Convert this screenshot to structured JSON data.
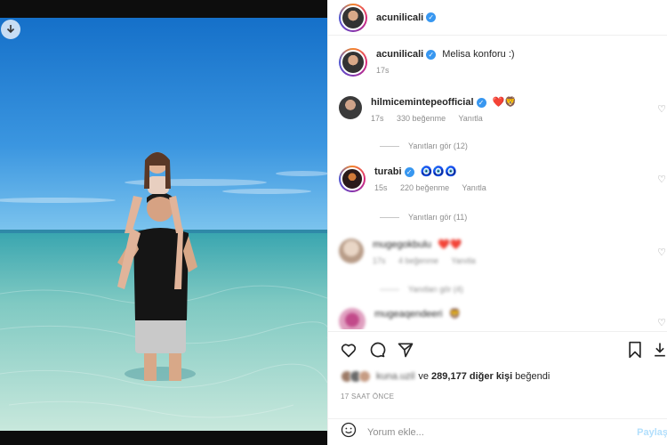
{
  "post": {
    "author": "acunilicali",
    "caption": "Melisa konforu :)",
    "caption_time": "17s"
  },
  "comments": [
    {
      "user": "hilmicemintepeofficial",
      "text": "❤️🦁",
      "time": "17s",
      "likes": "330 beğenme",
      "reply_label": "Yanıtla",
      "view_replies": "Yanıtları gör (12)"
    },
    {
      "user": "turabi",
      "text": "🧿🧿🧿",
      "time": "15s",
      "likes": "220 beğenme",
      "reply_label": "Yanıtla",
      "view_replies": "Yanıtları gör (11)"
    },
    {
      "user": "mugegokbulu",
      "text": "❤️❤️",
      "time": "17s",
      "likes": "4 beğenme",
      "reply_label": "Yanıtla",
      "view_replies": "Yanıtları gör (4)"
    },
    {
      "user": "mugeaqendeeri",
      "text": "🦁",
      "time": "",
      "likes": "",
      "reply_label": "",
      "view_replies": ""
    }
  ],
  "likes": {
    "prefix": "kuna.uzil",
    "conj": "ve",
    "count": "289,177 diğer kişi",
    "suffix": "beğendi"
  },
  "timestamp": "17 SAAT ÖNCE",
  "add_comment": {
    "placeholder": "Yorum ekle...",
    "post_label": "Paylaş"
  },
  "colors": {
    "verified": "#3897f0",
    "post_button": "#b2dffc",
    "heart": "#ed4956"
  }
}
